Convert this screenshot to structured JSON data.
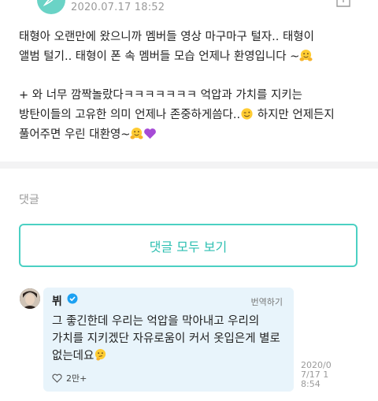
{
  "header": {
    "date": "2020.07.17 18:52",
    "avatar_icon": "feather-icon",
    "share_icon": "share-icon"
  },
  "post": {
    "line1": "태형아 오랜만에 왔으니까 멤버들 영상 마구마구 털자.. 태형이",
    "line2": "앨범 털기.. 태형이 폰 속 멤버들 모습 언제나 환영입니다 ~",
    "line3": "+ 와 너무 깜짝놀랐다ㅋㅋㅋㅋㅋㅋㅋ 억압과 가치를 지키는",
    "line4": "방탄이들의 고유한 의미 언제나 존중하게씀다..",
    "line4b": " 하지만 언제든지",
    "line5": "풀어주면 우린 대환영~"
  },
  "comments": {
    "label": "댓글",
    "view_all_label": "댓글 모두 보기"
  },
  "comment": {
    "author": "뷔",
    "translate_label": "번역하기",
    "text_line1": "그 좋긴한데 우리는 억압을 막아내고 우리의",
    "text_line2": "가치를 지키겠단 자유로움이 커서 옷입은게 별로",
    "text_line3": "없는데요",
    "likes": "2만+",
    "date": "2020/07/17 18:54"
  },
  "colors": {
    "accent": "#4bd0c3",
    "accent_text": "#2cbfb1",
    "comment_bg": "#e8f4fb",
    "verified": "#1da1f2"
  }
}
